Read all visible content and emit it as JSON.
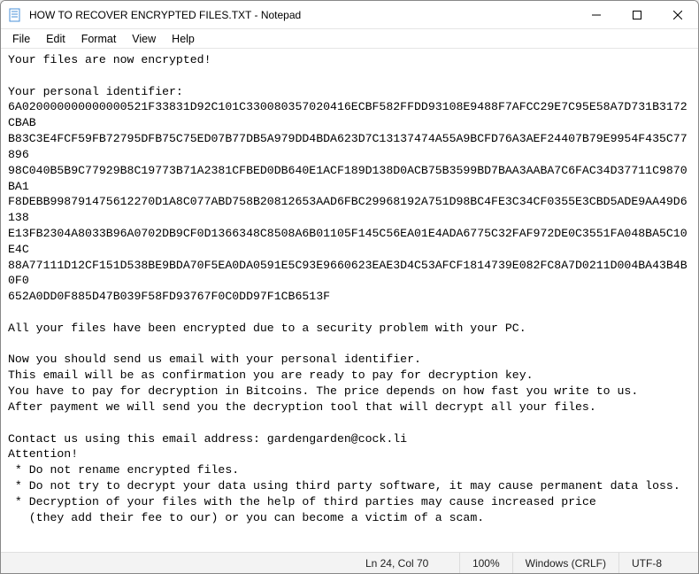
{
  "titlebar": {
    "title": "HOW TO RECOVER ENCRYPTED FILES.TXT - Notepad"
  },
  "menu": {
    "file": "File",
    "edit": "Edit",
    "format": "Format",
    "view": "View",
    "help": "Help"
  },
  "content": "Your files are now encrypted!\n\nYour personal identifier:\n6A020000000000000521F33831D92C101C330080357020416ECBF582FFDD93108E9488F7AFCC29E7C95E58A7D731B3172CBAB\nB83C3E4FCF59FB72795DFB75C75ED07B77DB5A979DD4BDA623D7C13137474A55A9BCFD76A3AEF24407B79E9954F435C77896\n98C040B5B9C77929B8C19773B71A2381CFBED0DB640E1ACF189D138D0ACB75B3599BD7BAA3AABA7C6FAC34D37711C9870BA1\nF8DEBB998791475612270D1A8C077ABD758B20812653AAD6FBC29968192A751D98BC4FE3C34CF0355E3CBD5ADE9AA49D6138\nE13FB2304A8033B96A0702DB9CF0D1366348C8508A6B01105F145C56EA01E4ADA6775C32FAF972DE0C3551FA048BA5C10E4C\n88A77111D12CF151D538BE9BDA70F5EA0DA0591E5C93E9660623EAE3D4C53AFCF1814739E082FC8A7D0211D004BA43B4B0F0\n652A0DD0F885D47B039F58FD93767F0C0DD97F1CB6513F\n\nAll your files have been encrypted due to a security problem with your PC.\n\nNow you should send us email with your personal identifier.\nThis email will be as confirmation you are ready to pay for decryption key.\nYou have to pay for decryption in Bitcoins. The price depends on how fast you write to us.\nAfter payment we will send you the decryption tool that will decrypt all your files.\n\nContact us using this email address: gardengarden@cock.li\nAttention!\n * Do not rename encrypted files.\n * Do not try to decrypt your data using third party software, it may cause permanent data loss.\n * Decryption of your files with the help of third parties may cause increased price\n   (they add their fee to our) or you can become a victim of a scam.",
  "status": {
    "cursor": "Ln 24, Col 70",
    "zoom": "100%",
    "lineending": "Windows (CRLF)",
    "encoding": "UTF-8"
  }
}
